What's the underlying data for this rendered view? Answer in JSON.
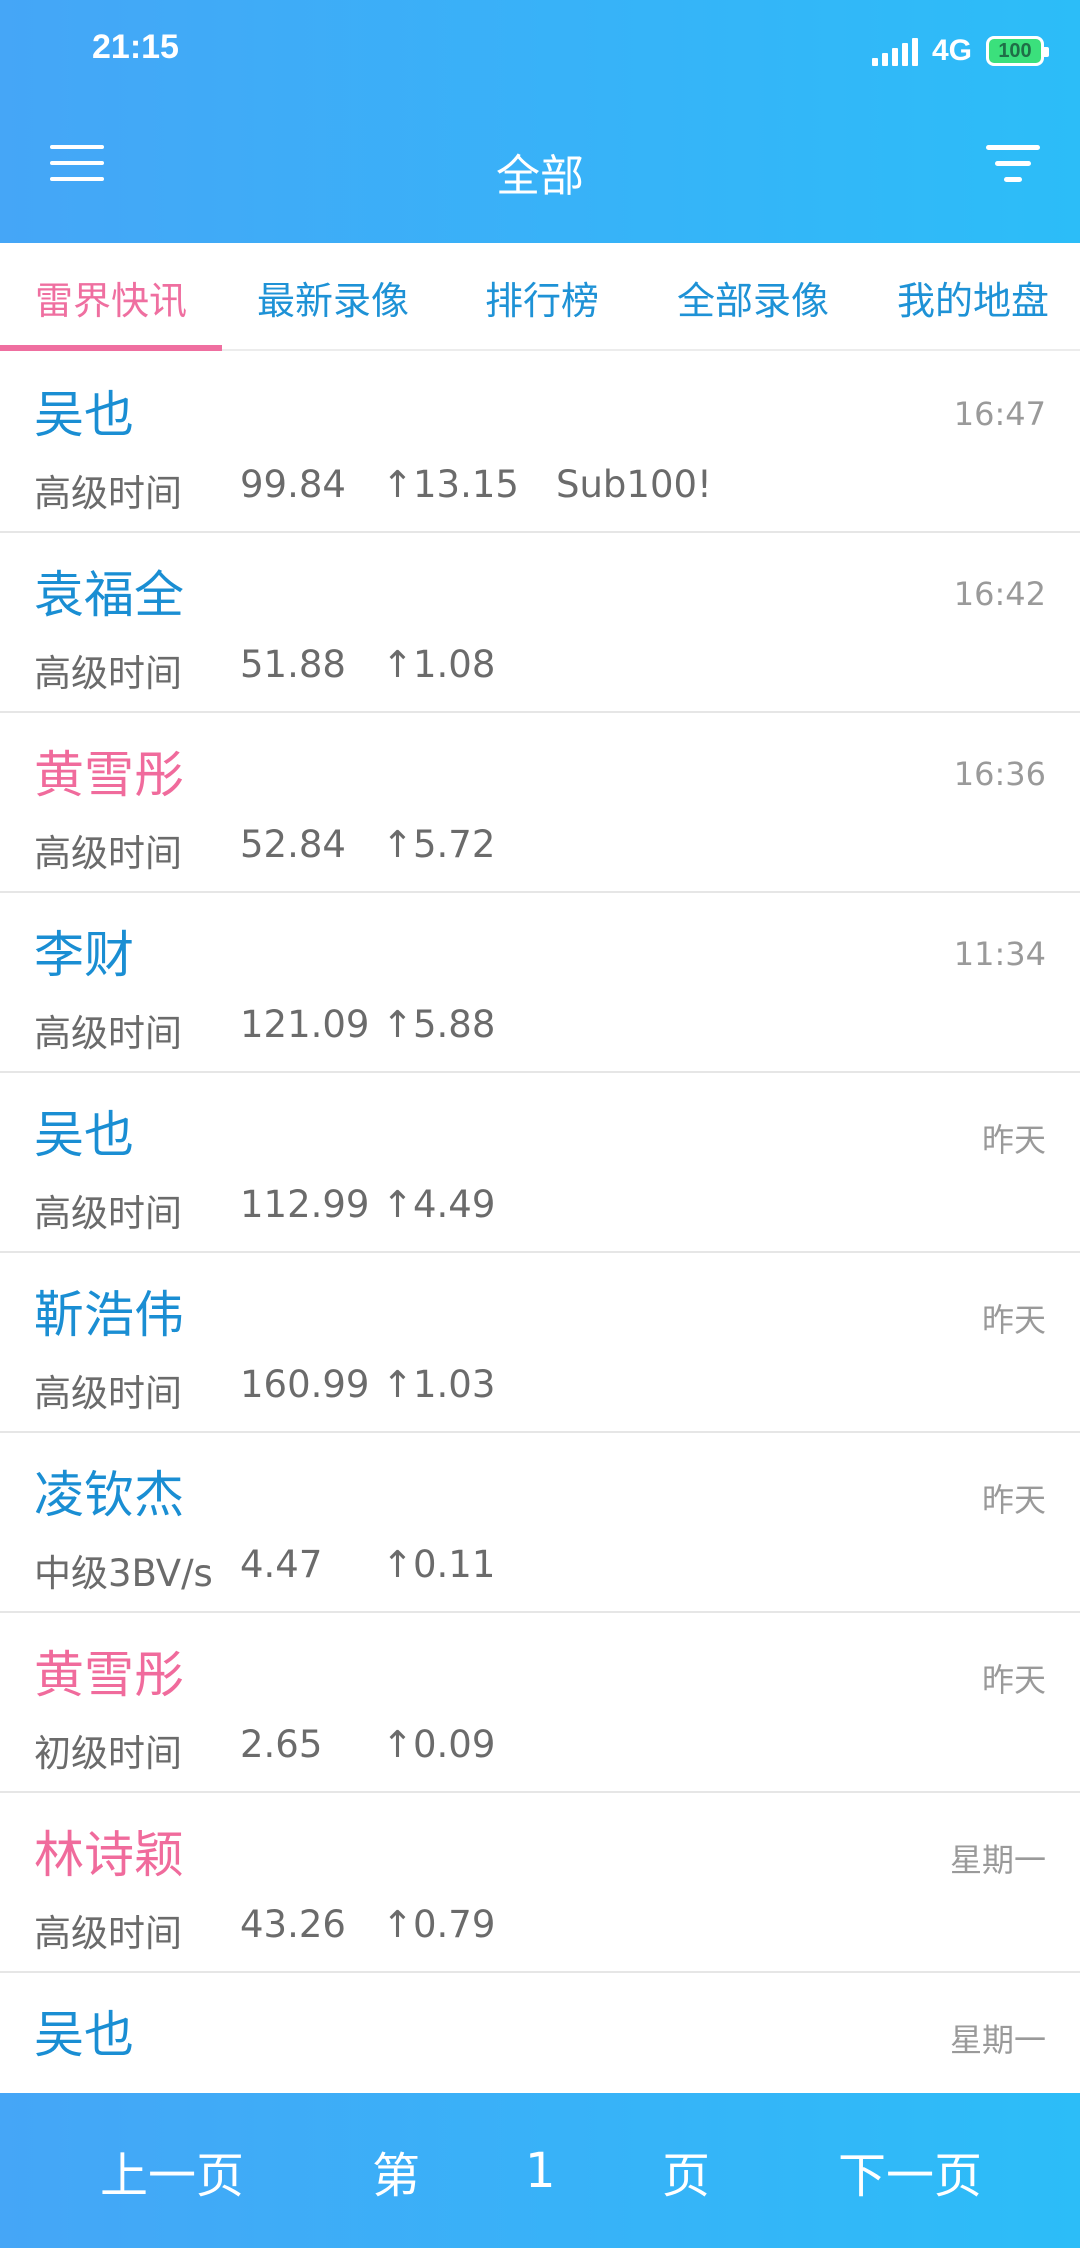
{
  "status_bar": {
    "time": "21:15",
    "network": "4G",
    "battery": "100"
  },
  "header": {
    "title": "全部",
    "menu_icon": "menu-icon",
    "filter_icon": "filter-icon"
  },
  "tabs": [
    {
      "label": "雷界快讯",
      "active": true
    },
    {
      "label": "最新录像",
      "active": false
    },
    {
      "label": "排行榜",
      "active": false
    },
    {
      "label": "全部录像",
      "active": false
    },
    {
      "label": "我的地盘",
      "active": false
    }
  ],
  "colors": {
    "accent_blue": "#1a8ed3",
    "accent_pink": "#f06b9c",
    "header_gradient_start": "#45a6f7",
    "header_gradient_end": "#2cbdf8"
  },
  "entries": [
    {
      "name": "吴也",
      "name_color": "blue",
      "time": "16:47",
      "level": "高级时间",
      "value": "99.84",
      "delta": "↑13.15",
      "note": "Sub100!"
    },
    {
      "name": "袁福全",
      "name_color": "blue",
      "time": "16:42",
      "level": "高级时间",
      "value": "51.88",
      "delta": "↑1.08",
      "note": ""
    },
    {
      "name": "黄雪彤",
      "name_color": "pink",
      "time": "16:36",
      "level": "高级时间",
      "value": "52.84",
      "delta": "↑5.72",
      "note": ""
    },
    {
      "name": "李财",
      "name_color": "blue",
      "time": "11:34",
      "level": "高级时间",
      "value": "121.09",
      "delta": "↑5.88",
      "note": ""
    },
    {
      "name": "吴也",
      "name_color": "blue",
      "time": "昨天",
      "level": "高级时间",
      "value": "112.99",
      "delta": "↑4.49",
      "note": ""
    },
    {
      "name": "靳浩伟",
      "name_color": "blue",
      "time": "昨天",
      "level": "高级时间",
      "value": "160.99",
      "delta": "↑1.03",
      "note": ""
    },
    {
      "name": "凌钦杰",
      "name_color": "blue",
      "time": "昨天",
      "level": "中级3BV/s",
      "value": "4.47",
      "delta": "↑0.11",
      "note": ""
    },
    {
      "name": "黄雪彤",
      "name_color": "pink",
      "time": "昨天",
      "level": "初级时间",
      "value": "2.65",
      "delta": "↑0.09",
      "note": ""
    },
    {
      "name": "林诗颖",
      "name_color": "pink",
      "time": "星期一",
      "level": "高级时间",
      "value": "43.26",
      "delta": "↑0.79",
      "note": ""
    },
    {
      "name": "吴也",
      "name_color": "blue",
      "time": "星期一",
      "level": "",
      "value": "",
      "delta": "",
      "note": ""
    }
  ],
  "pager": {
    "prev": "上一页",
    "page_prefix": "第",
    "page_number": "1",
    "page_suffix": "页",
    "next": "下一页"
  }
}
